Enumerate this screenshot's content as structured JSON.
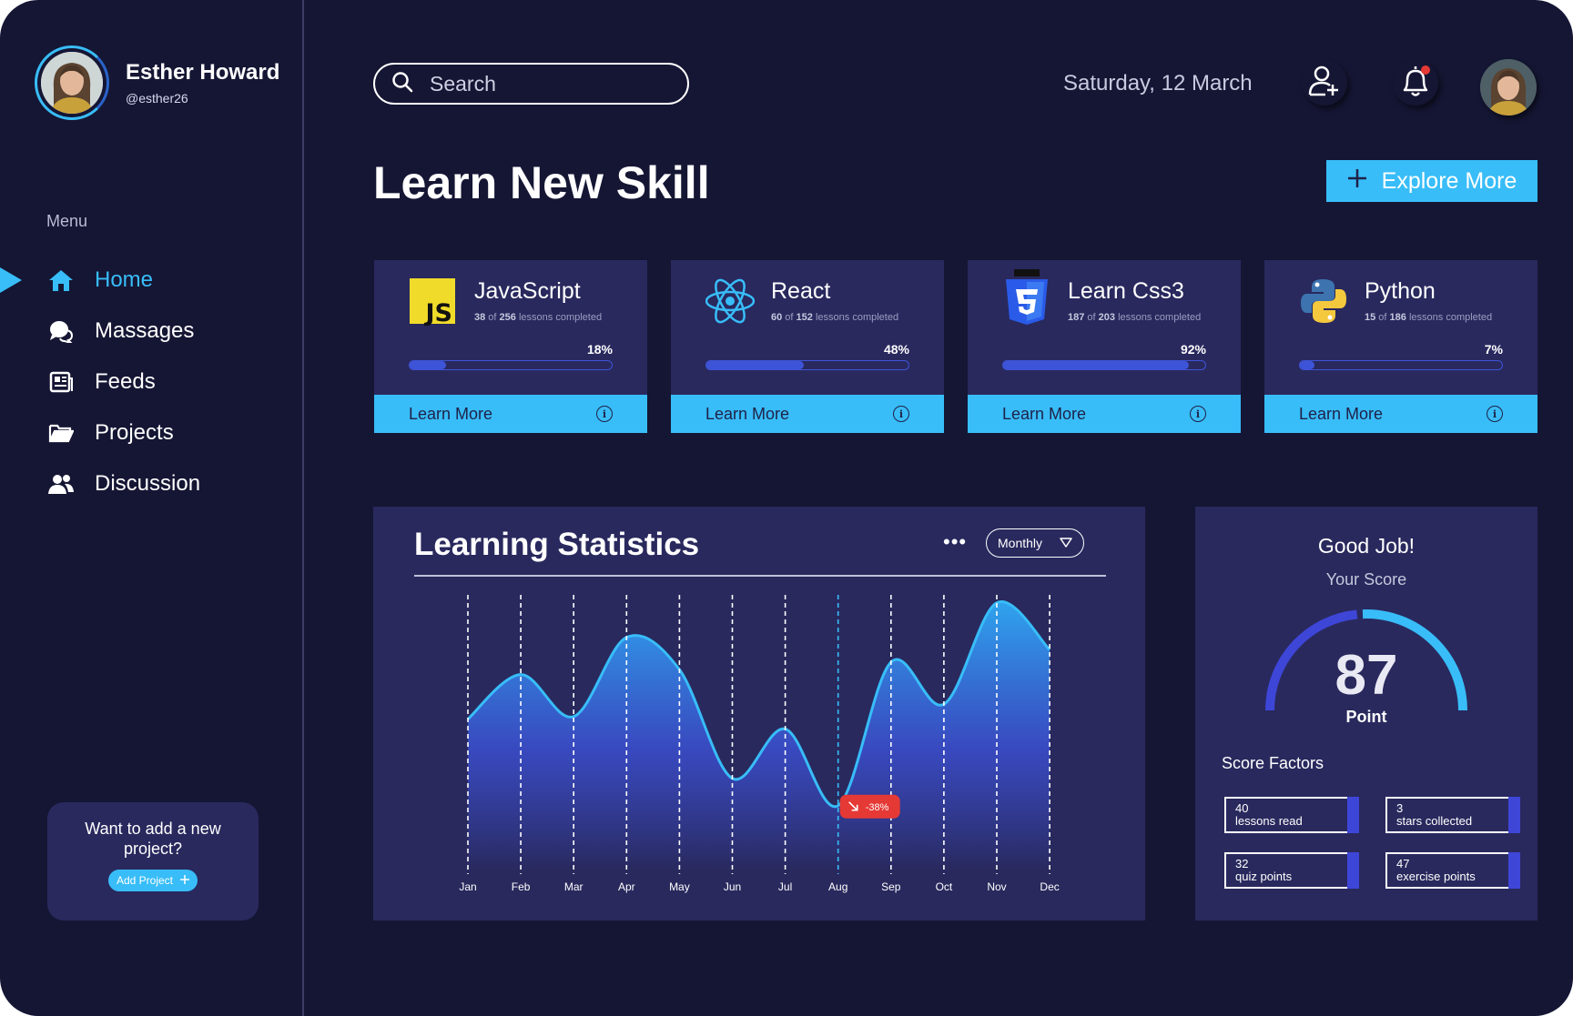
{
  "user": {
    "name": "Esther Howard",
    "handle": "@esther26"
  },
  "sidebar": {
    "menu_label": "Menu",
    "items": [
      {
        "label": "Home",
        "icon": "home-icon",
        "active": true
      },
      {
        "label": "Massages",
        "icon": "chat-icon",
        "active": false
      },
      {
        "label": "Feeds",
        "icon": "newspaper-icon",
        "active": false
      },
      {
        "label": "Projects",
        "icon": "folder-icon",
        "active": false
      },
      {
        "label": "Discussion",
        "icon": "people-icon",
        "active": false
      }
    ],
    "add_project": {
      "text": "Want to add a new project?",
      "button": "Add Project"
    }
  },
  "header": {
    "search_placeholder": "Search",
    "date": "Saturday, 12 March"
  },
  "page": {
    "title": "Learn New Skill",
    "explore_button": "Explore More"
  },
  "courses": [
    {
      "title": "JavaScript",
      "done": "38",
      "total": "256",
      "suffix": "lessons completed",
      "percent_label": "18%",
      "progress": 0.18,
      "action": "Learn More"
    },
    {
      "title": "React",
      "done": "60",
      "total": "152",
      "suffix": "lessons completed",
      "percent_label": "48%",
      "progress": 0.48,
      "action": "Learn More"
    },
    {
      "title": "Learn Css3",
      "done": "187",
      "total": "203",
      "suffix": "lessons completed",
      "percent_label": "92%",
      "progress": 0.92,
      "action": "Learn More"
    },
    {
      "title": "Python",
      "done": "15",
      "total": "186",
      "suffix": "lessons completed",
      "percent_label": "7%",
      "progress": 0.07,
      "action": "Learn More"
    }
  ],
  "stats": {
    "title": "Learning Statistics",
    "period": "Monthly",
    "badge": "-38%"
  },
  "chart_data": {
    "type": "area",
    "x": [
      "Jan",
      "Feb",
      "Mar",
      "Apr",
      "May",
      "Jun",
      "Jul",
      "Aug",
      "Sep",
      "Oct",
      "Nov",
      "Dec"
    ],
    "values": [
      52,
      70,
      53,
      85,
      72,
      28,
      48,
      17,
      75,
      58,
      99,
      80
    ],
    "ylim": [
      0,
      100
    ],
    "grid": "vertical-dashed",
    "highlight": {
      "index": 7,
      "label": "-38%"
    },
    "colors": {
      "line": "#38bdf8",
      "fill_top": "#2fa4ee",
      "fill_bottom": "#29295e",
      "badge": "#e53935"
    }
  },
  "score": {
    "title": "Good Job!",
    "subtitle": "Your Score",
    "value": "87",
    "unit": "Point",
    "fraction": 0.87,
    "factors_label": "Score Factors",
    "factors": [
      {
        "value": "40",
        "label": "lessons read"
      },
      {
        "value": "3",
        "label": "stars collected"
      },
      {
        "value": "32",
        "label": "quiz points"
      },
      {
        "value": "47",
        "label": "exercise points"
      }
    ]
  },
  "colors": {
    "background": "#151634",
    "card": "#29295e",
    "accent": "#38bdf8",
    "progress": "#3e54d8"
  }
}
